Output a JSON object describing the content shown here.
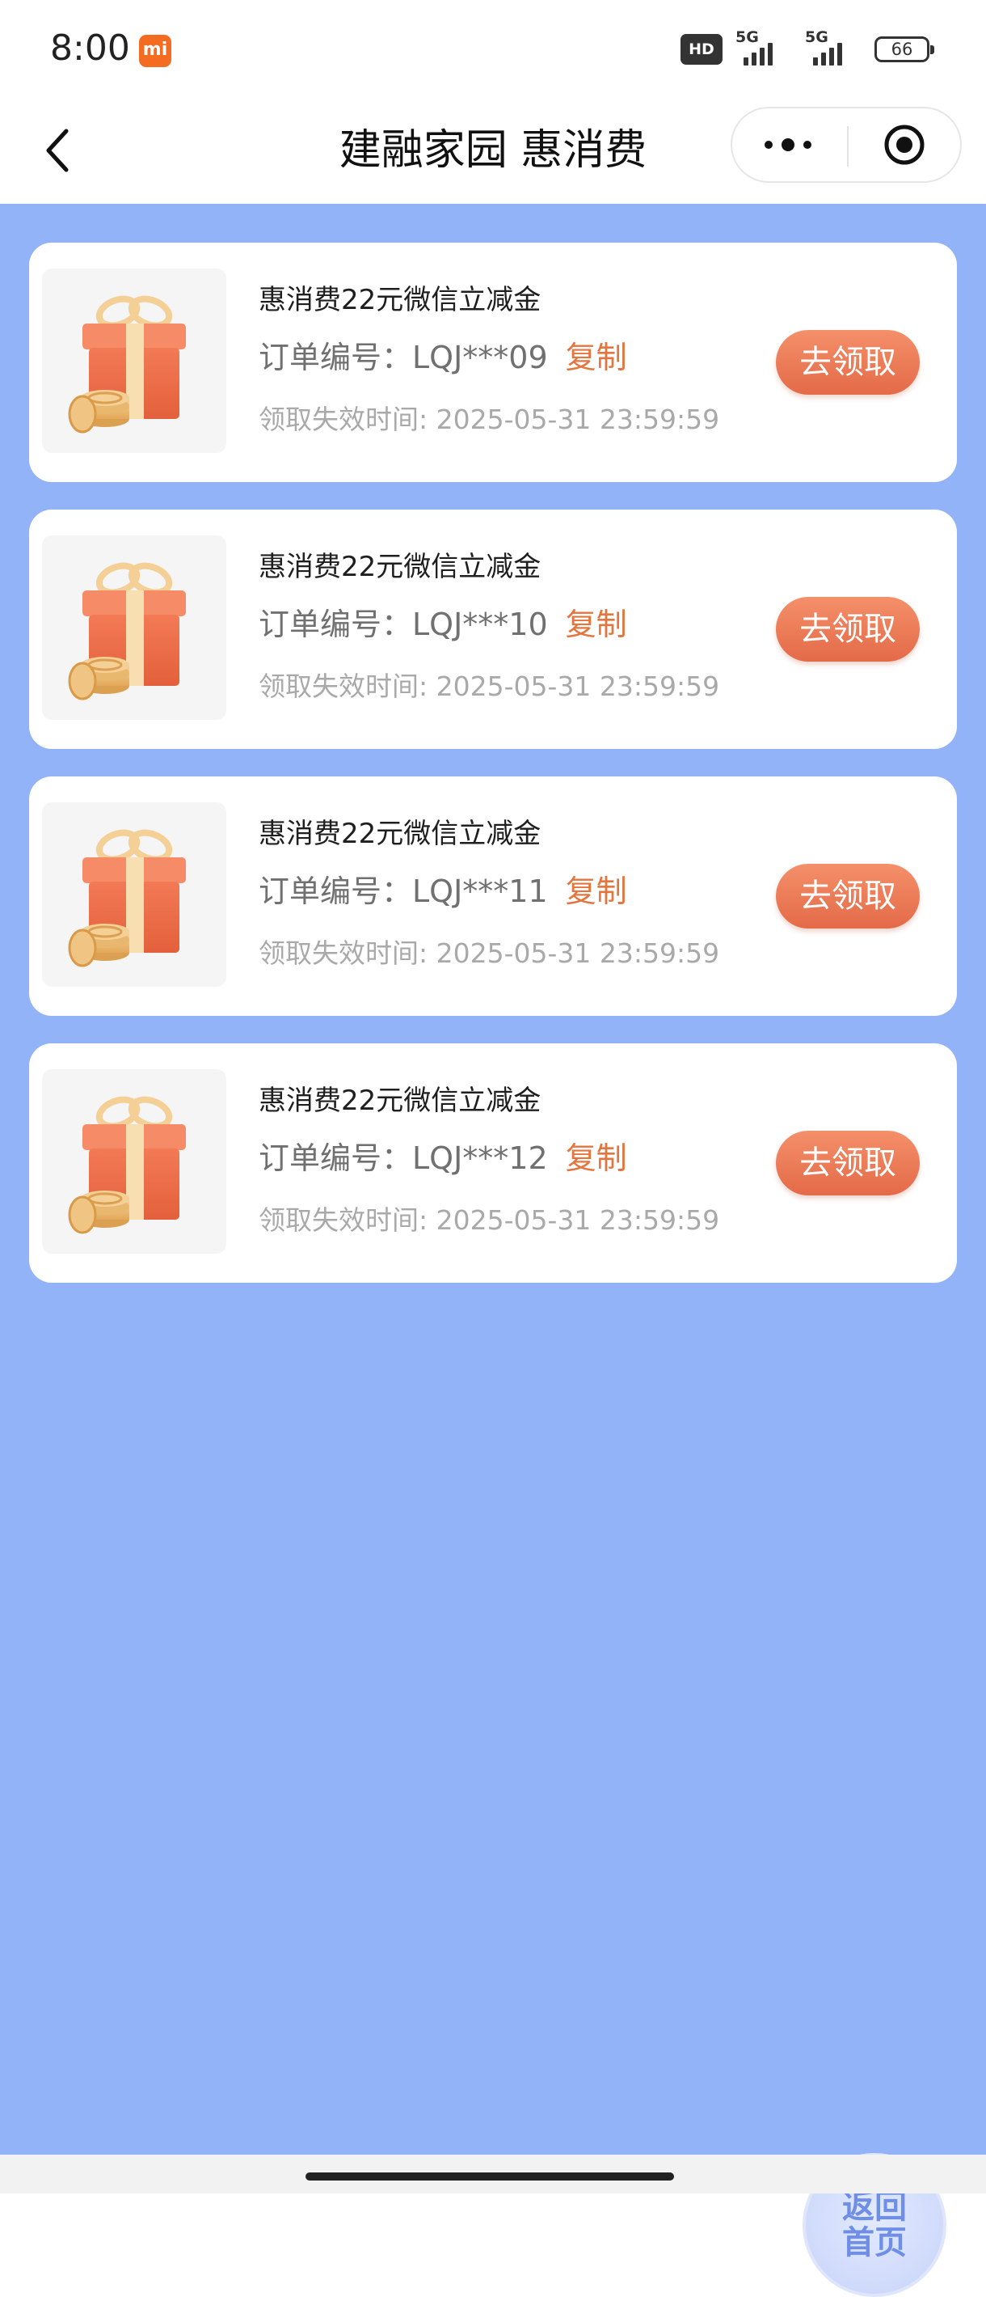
{
  "status_bar": {
    "time": "8:00",
    "hd_label": "HD",
    "network_1": "5G",
    "network_2": "5G",
    "battery": "66"
  },
  "nav": {
    "title": "建融家园 惠消费",
    "back_icon": "chevron-left-icon",
    "more_icon": "more-dots-icon",
    "close_icon": "target-circle-icon"
  },
  "colors": {
    "page_background": "#93b3f8",
    "accent": "#e4753f",
    "button_gradient_top": "#f4906a",
    "button_gradient_bottom": "#e46a48"
  },
  "coupons": [
    {
      "title": "惠消费22元微信立减金",
      "order_label": "订单编号：",
      "order_no": "LQJ***09",
      "copy_label": "复制",
      "expire_text": "领取失效时间: 2025-05-31 23:59:59",
      "action_label": "去领取",
      "icon": "gift-box-icon"
    },
    {
      "title": "惠消费22元微信立减金",
      "order_label": "订单编号：",
      "order_no": "LQJ***10",
      "copy_label": "复制",
      "expire_text": "领取失效时间: 2025-05-31 23:59:59",
      "action_label": "去领取",
      "icon": "gift-box-icon"
    },
    {
      "title": "惠消费22元微信立减金",
      "order_label": "订单编号：",
      "order_no": "LQJ***11",
      "copy_label": "复制",
      "expire_text": "领取失效时间: 2025-05-31 23:59:59",
      "action_label": "去领取",
      "icon": "gift-box-icon"
    },
    {
      "title": "惠消费22元微信立减金",
      "order_label": "订单编号：",
      "order_no": "LQJ***12",
      "copy_label": "复制",
      "expire_text": "领取失效时间: 2025-05-31 23:59:59",
      "action_label": "去领取",
      "icon": "gift-box-icon"
    }
  ],
  "fab": {
    "line1": "返回",
    "line2": "首页"
  }
}
